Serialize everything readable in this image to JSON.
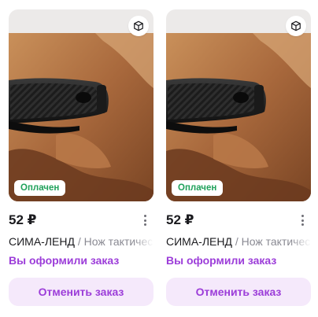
{
  "colors": {
    "accent": "#9c3dd9",
    "accent_bg": "#f5e9fb",
    "paid_green": "#1fa15a",
    "text_primary": "#1b1b1f",
    "text_secondary": "#8a8a93"
  },
  "cards": [
    {
      "image_icon": "3d-cube-icon",
      "badge": "Оплачен",
      "price": "52 ₽",
      "brand": "СИМА-ЛЕНД",
      "separator": " / ",
      "name": "Нож тактический",
      "status": "Вы оформили заказ",
      "cancel_label": "Отменить заказ"
    },
    {
      "image_icon": "3d-cube-icon",
      "badge": "Оплачен",
      "price": "52 ₽",
      "brand": "СИМА-ЛЕНД",
      "separator": " / ",
      "name": "Нож тактический",
      "status": "Вы оформили заказ",
      "cancel_label": "Отменить заказ"
    }
  ]
}
